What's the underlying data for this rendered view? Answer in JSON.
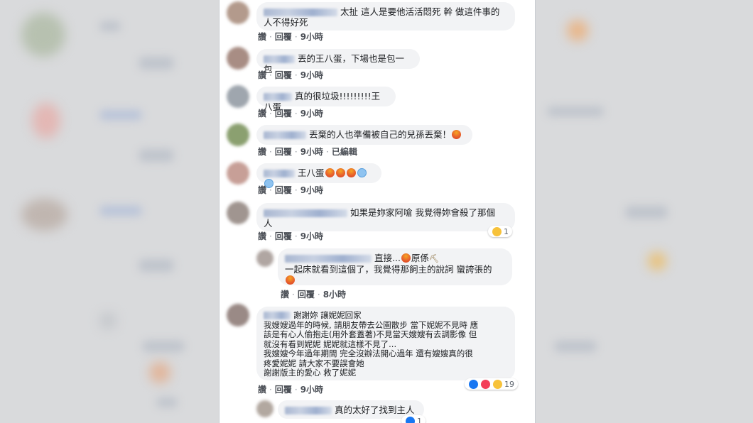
{
  "comments": [
    {
      "text_l1": "太扯 這人是要他活活悶死 幹 做這件事的",
      "text_l2": "人不得好死",
      "like": "讚",
      "reply": "回覆",
      "time": "9小時"
    },
    {
      "text": "丟的王八蛋，下場也是包一包",
      "like": "讚",
      "reply": "回覆",
      "time": "9小時"
    },
    {
      "text": "真的很垃圾!!!!!!!!!王八蛋",
      "like": "讚",
      "reply": "回覆",
      "time": "9小時"
    },
    {
      "text": "丟棄的人也準備被自己的兒孫丟棄！",
      "like": "讚",
      "reply": "回覆",
      "time": "9小時",
      "edited": "已編輯"
    },
    {
      "text": "王八蛋",
      "like": "讚",
      "reply": "回覆",
      "time": "9小時"
    },
    {
      "text_l1": "如果是妳家阿嗆 我覺得妳會殺了那個",
      "text_l2": "人",
      "like": "讚",
      "reply": "回覆",
      "time": "9小時",
      "reaction_count": "1"
    },
    {
      "text_l1a": "直接...",
      "text_l1b": "原係",
      "text_l2": "一起床就看到這個了，我覺得那飼主的說詞 蠻誇張的",
      "like": "讚",
      "reply": "回覆",
      "time": "8小時"
    },
    {
      "lines": [
        "謝謝妳 讓妮妮回家",
        "我嫂嫂過年的時候, 請朋友帶去公園散步 當下妮妮不見時 應",
        "該是有心人偷抱走(用外套蓋著)不見當天嫂嫂有去調影像 但",
        "就沒有看到妮妮 妮妮就這樣不見了...",
        "我嫂嫂今年過年期間 完全沒辦法開心過年 還有嫂嫂真的很",
        "疼愛妮妮 請大家不要誤會她",
        "謝謝版主的愛心 救了妮妮"
      ],
      "like": "讚",
      "reply": "回覆",
      "time": "9小時",
      "reaction_count": "19"
    },
    {
      "text": "真的太好了找到主人",
      "reaction_count": "1"
    }
  ]
}
